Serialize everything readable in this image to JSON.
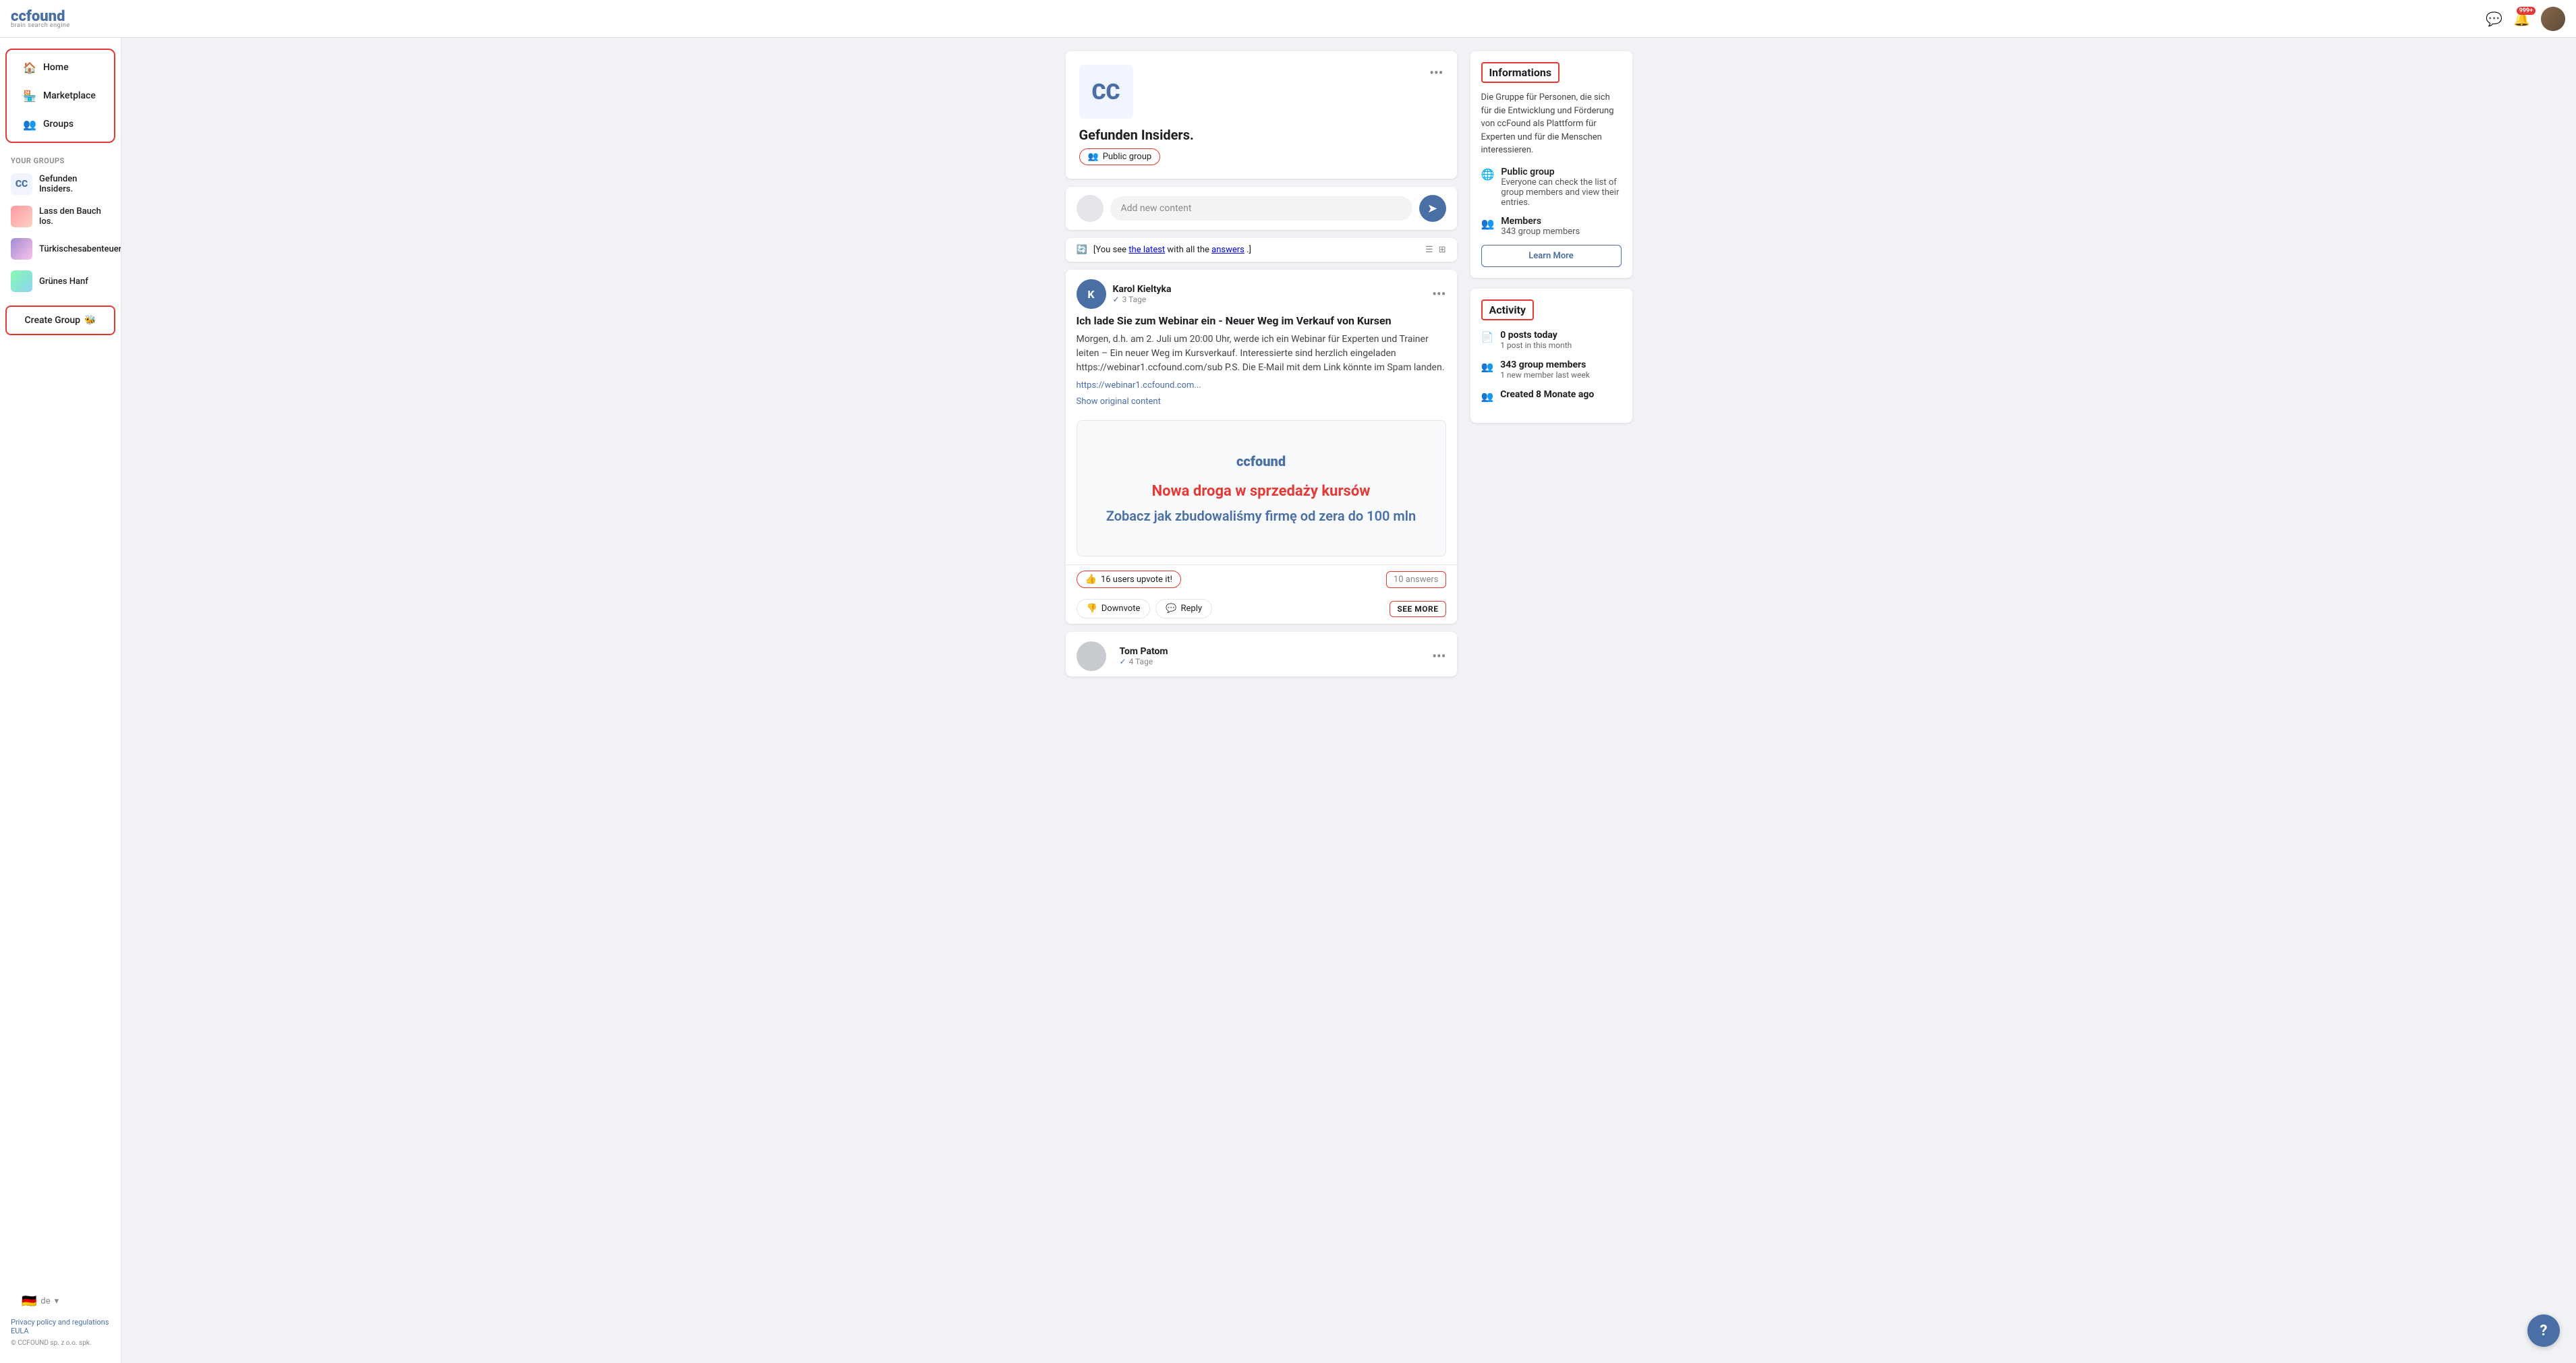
{
  "topbar": {
    "logo": "ccfound",
    "logo_sub": "brain search engine",
    "help_label": "?",
    "notification_badge": "999+"
  },
  "sidebar": {
    "nav_items": [
      {
        "id": "home",
        "label": "Home",
        "icon": "🏠",
        "active": true
      },
      {
        "id": "marketplace",
        "label": "Marketplace",
        "icon": "🏪",
        "active": false
      },
      {
        "id": "groups",
        "label": "Groups",
        "icon": "👥",
        "active": false
      }
    ],
    "your_groups_label": "YOUR GROUPS",
    "groups": [
      {
        "id": "gefunden-insiders",
        "name": "Gefunden Insiders.",
        "avatar_type": "cc"
      },
      {
        "id": "lass-den-bauch",
        "name": "Lass den Bauch los.",
        "avatar_type": "img"
      },
      {
        "id": "turkisches",
        "name": "Türkischesabenteuer.de",
        "avatar_type": "img"
      },
      {
        "id": "grunes-hanf",
        "name": "Grünes Hanf",
        "avatar_type": "img"
      }
    ],
    "create_group_label": "Create Group",
    "language_label": "de",
    "footer_links": [
      "Privacy policy and regulations",
      "EULA"
    ],
    "footer_copy": "© CCFOUND sp. z o.o. spk."
  },
  "group_header": {
    "logo_text": "CC",
    "group_name": "Gefunden Insiders.",
    "public_group_label": "Public group",
    "three_dots_label": "•••"
  },
  "post_input": {
    "placeholder": "Add new content",
    "submit_icon": "➤"
  },
  "latest_notice": {
    "text_prefix": "[You see ",
    "link_latest": "the latest",
    "text_middle": " with all the ",
    "link_answers": "answers",
    "text_suffix": ".]"
  },
  "post": {
    "author_name": "Karol Kieltyka",
    "author_verified": "✓",
    "author_time": "3 Tage",
    "title": "Ich lade Sie zum Webinar ein - Neuer Weg im Verkauf von Kursen",
    "body": "Morgen, d.h. am 2. Juli um 20:00 Uhr, werde ich ein Webinar für Experten und Trainer leiten – Ein neuer Weg im Kursverkauf. Interessierte sind herzlich eingeladen https://webinar1.ccfound.com/sub P.S. Die E-Mail mit dem Link könnte im Spam landen.",
    "link": "https://webinar1.ccfound.com...",
    "show_original": "Show original content",
    "preview_logo": "ccfound",
    "preview_title": "Nowa droga w sprzedaży kursów",
    "preview_subtitle": "Zobacz jak zbudowaliśmy firmę od zera do 100 mln",
    "upvote_label": "16 users upvote it!",
    "answers_label": "10 answers",
    "downvote_label": "Downvote",
    "reply_label": "Reply",
    "see_more_label": "SEE MORE"
  },
  "second_post": {
    "author_name": "Tom Patom",
    "author_verified": "✓",
    "author_time": "4 Tage",
    "three_dots_label": "•••"
  },
  "informations": {
    "title": "Informations",
    "description": "Die Gruppe für Personen, die sich für die Entwicklung und Förderung von ccFound als Plattform für Experten und für die Menschen interessieren.",
    "public_group_title": "Public group",
    "public_group_text": "Everyone can check the list of group members and view their entries.",
    "members_title": "Members",
    "members_text": "343 group members",
    "learn_more_label": "Learn More"
  },
  "activity": {
    "title": "Activity",
    "rows": [
      {
        "icon": "doc",
        "main": "0 posts today",
        "sub": "1 post in this month"
      },
      {
        "icon": "people",
        "main": "343 group members",
        "sub": "1 new member last week"
      },
      {
        "icon": "people",
        "main": "Created 8 Monate ago",
        "sub": ""
      }
    ]
  }
}
